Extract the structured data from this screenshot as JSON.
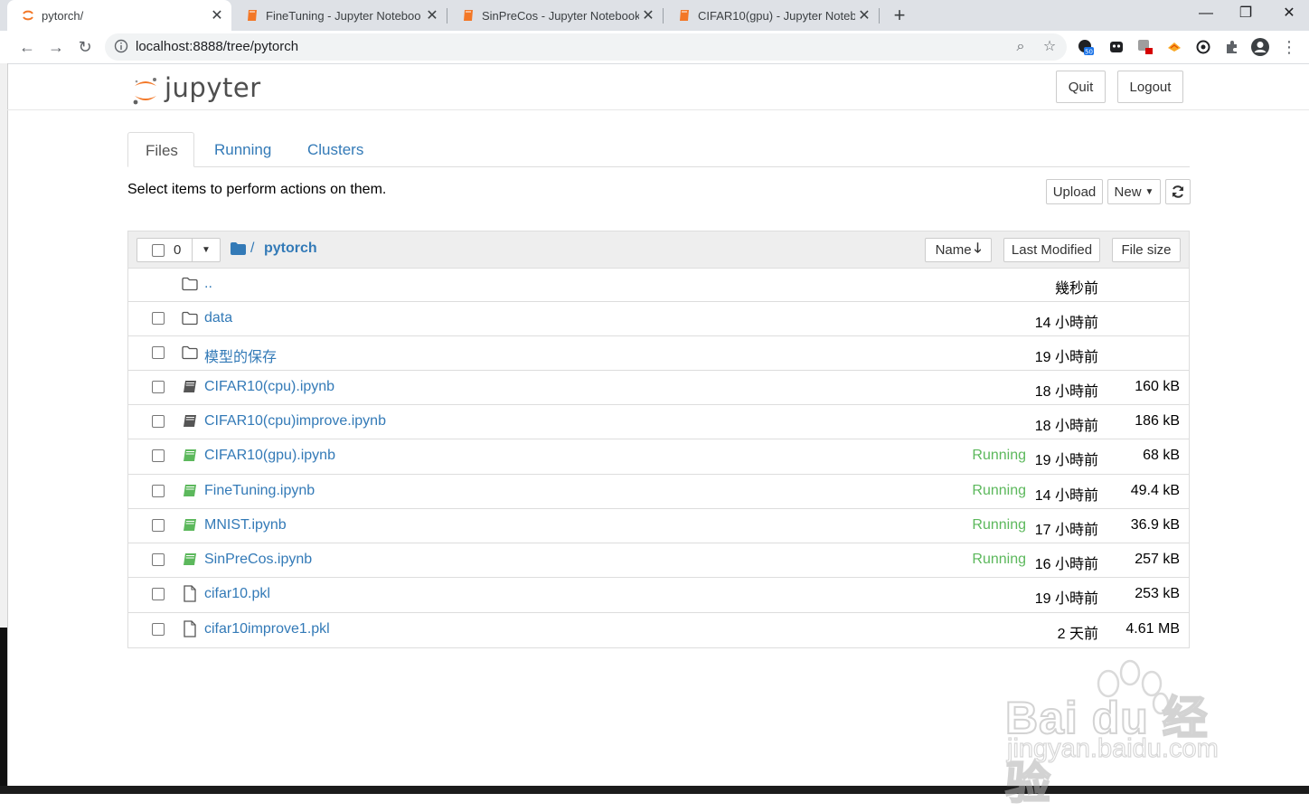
{
  "browser": {
    "tabs": [
      {
        "title": "pytorch/",
        "active": true
      },
      {
        "title": "FineTuning - Jupyter Noteboo",
        "active": false
      },
      {
        "title": "SinPreCos - Jupyter Notebook",
        "active": false
      },
      {
        "title": "CIFAR10(gpu) - Jupyter Noteb",
        "active": false
      }
    ],
    "url": "localhost:8888/tree/pytorch",
    "extension_badge": "50",
    "accent_color": "#f37726"
  },
  "header": {
    "logo_text": "jupyter",
    "quit_label": "Quit",
    "logout_label": "Logout"
  },
  "nav_tabs": [
    "Files",
    "Running",
    "Clusters"
  ],
  "toolbar": {
    "hint": "Select items to perform actions on them.",
    "upload_label": "Upload",
    "new_label": "New"
  },
  "list_header": {
    "selected_count": "0",
    "breadcrumb_sep": "/",
    "current_dir": "pytorch",
    "sort_name": "Name",
    "sort_modified": "Last Modified",
    "sort_size": "File size"
  },
  "files": [
    {
      "type": "parent",
      "name": "..",
      "running": "",
      "modified": "幾秒前",
      "size": ""
    },
    {
      "type": "folder",
      "name": "data",
      "running": "",
      "modified": "14 小時前",
      "size": ""
    },
    {
      "type": "folder",
      "name": "模型的保存",
      "running": "",
      "modified": "19 小時前",
      "size": ""
    },
    {
      "type": "notebook",
      "name": "CIFAR10(cpu).ipynb",
      "running": "",
      "modified": "18 小時前",
      "size": "160 kB"
    },
    {
      "type": "notebook",
      "name": "CIFAR10(cpu)improve.ipynb",
      "running": "",
      "modified": "18 小時前",
      "size": "186 kB"
    },
    {
      "type": "notebook-running",
      "name": "CIFAR10(gpu).ipynb",
      "running": "Running",
      "modified": "19 小時前",
      "size": "68 kB"
    },
    {
      "type": "notebook-running",
      "name": "FineTuning.ipynb",
      "running": "Running",
      "modified": "14 小時前",
      "size": "49.4 kB"
    },
    {
      "type": "notebook-running",
      "name": "MNIST.ipynb",
      "running": "Running",
      "modified": "17 小時前",
      "size": "36.9 kB"
    },
    {
      "type": "notebook-running",
      "name": "SinPreCos.ipynb",
      "running": "Running",
      "modified": "16 小時前",
      "size": "257 kB"
    },
    {
      "type": "file",
      "name": "cifar10.pkl",
      "running": "",
      "modified": "19 小時前",
      "size": "253 kB"
    },
    {
      "type": "file",
      "name": "cifar10improve1.pkl",
      "running": "",
      "modified": "2 天前",
      "size": "4.61 MB"
    }
  ],
  "watermark": {
    "line1": "Bai du 经验",
    "line2": "jingyan.baidu.com"
  }
}
